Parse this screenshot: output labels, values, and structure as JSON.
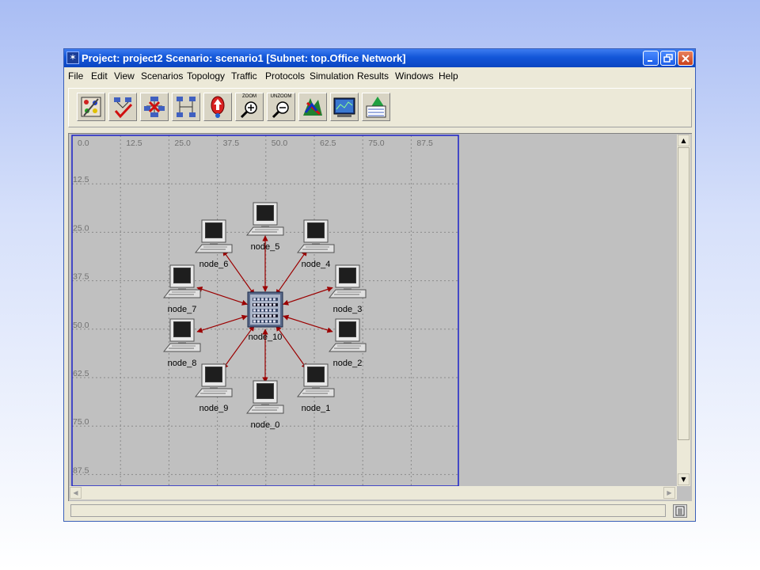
{
  "window": {
    "title": "Project: project2 Scenario: scenario1  [Subnet: top.Office Network]"
  },
  "menu": [
    "File",
    "Edit",
    "View",
    "Scenarios",
    "Topology",
    "Traffic",
    "Protocols",
    "Simulation",
    "Results",
    "Windows",
    "Help"
  ],
  "toolbar": {
    "buttons": [
      {
        "name": "open-object-palette",
        "icon": "palette-icon"
      },
      {
        "name": "check-link-consistency",
        "icon": "checkmark-link-icon"
      },
      {
        "name": "fail-selected-objects",
        "icon": "fail-node-icon"
      },
      {
        "name": "recover-selected-objects",
        "icon": "recover-node-icon"
      },
      {
        "name": "return-to-parent-subnet",
        "icon": "up-arrow-icon"
      },
      {
        "name": "zoom",
        "icon": "zoom-in-icon",
        "label": "ZOOM"
      },
      {
        "name": "unzoom",
        "icon": "zoom-out-icon",
        "label": "UNZOOM"
      },
      {
        "name": "configure-run-simulation",
        "icon": "run-simulation-icon"
      },
      {
        "name": "view-results",
        "icon": "results-graph-icon"
      },
      {
        "name": "hide-show-graphs",
        "icon": "graph-panels-icon"
      }
    ]
  },
  "grid": {
    "x_labels": [
      "0.0",
      "12.5",
      "25.0",
      "37.5",
      "50.0",
      "62.5",
      "75.0",
      "87.5"
    ],
    "y_labels": [
      "12.5",
      "25.0",
      "37.5",
      "50.0",
      "62.5",
      "75.0",
      "87.5"
    ]
  },
  "network": {
    "hub": {
      "label": "node_10",
      "icon": "switch-hub-icon"
    },
    "nodes": [
      {
        "label": "node_0",
        "icon": "workstation-icon"
      },
      {
        "label": "node_1",
        "icon": "workstation-icon"
      },
      {
        "label": "node_2",
        "icon": "workstation-icon"
      },
      {
        "label": "node_3",
        "icon": "workstation-icon"
      },
      {
        "label": "node_4",
        "icon": "workstation-icon"
      },
      {
        "label": "node_5",
        "icon": "workstation-icon"
      },
      {
        "label": "node_6",
        "icon": "workstation-icon"
      },
      {
        "label": "node_7",
        "icon": "workstation-icon"
      },
      {
        "label": "node_8",
        "icon": "workstation-icon"
      },
      {
        "label": "node_9",
        "icon": "workstation-icon"
      }
    ],
    "link_color": "#9b0000"
  },
  "colors": {
    "titlebar": "#0b45c2",
    "workspace": "#c0c0c0",
    "subnet_border": "#1a20c8"
  }
}
